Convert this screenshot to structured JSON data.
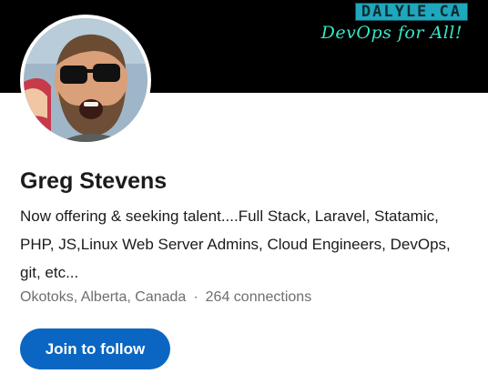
{
  "banner": {
    "brand": "DALYLE.CA",
    "tagline": "DevOps for All!"
  },
  "profile": {
    "name": "Greg Stevens",
    "headline": "Now offering & seeking talent....Full Stack, Laravel, Statamic, PHP, JS,Linux Web Server Admins, Cloud Engineers, DevOps, git, etc...",
    "location": "Okotoks, Alberta, Canada",
    "separator": "·",
    "connections": "264 connections"
  },
  "actions": {
    "follow_label": "Join to follow"
  },
  "colors": {
    "accent": "#0a66c2",
    "banner_bg": "#000000",
    "brand_bg": "#1fa7bd",
    "tagline": "#39e6c6"
  }
}
